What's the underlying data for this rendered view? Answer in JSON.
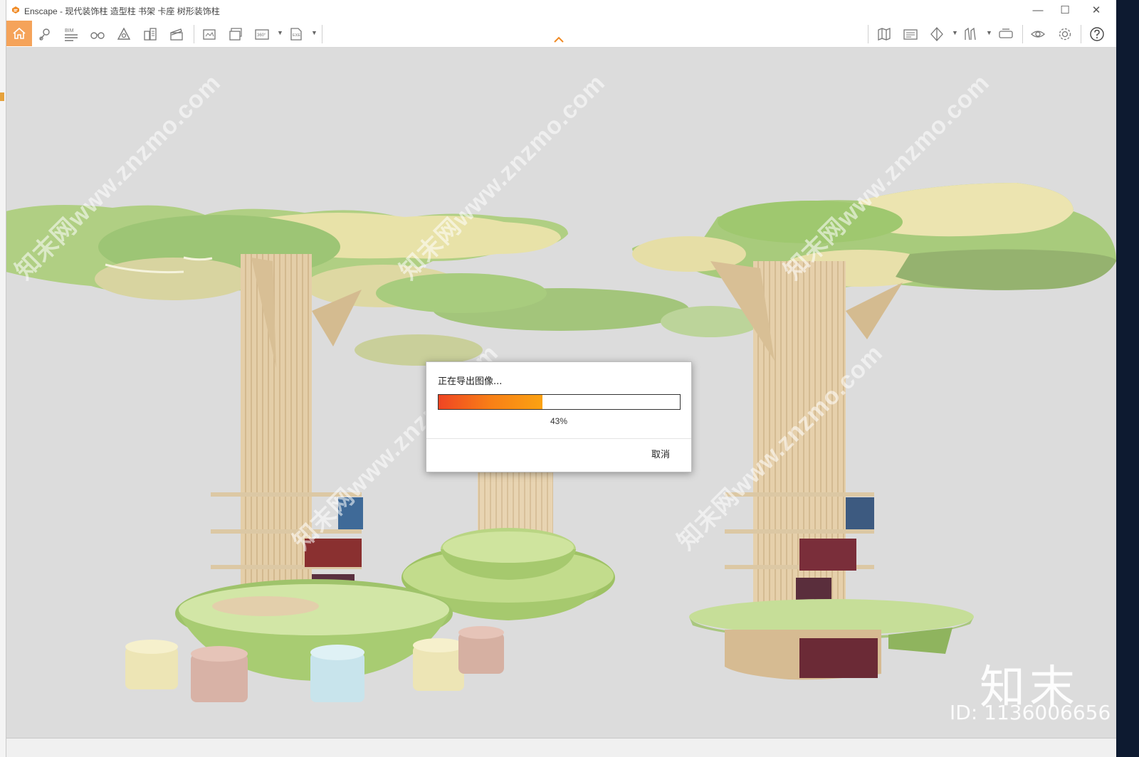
{
  "window": {
    "title": "Enscape - 现代装饰柱 造型柱 书架 卡座 树形装饰柱",
    "minimize_label": "—",
    "maximize_label": "☐",
    "close_label": "✕"
  },
  "toolbar": {
    "accent_color": "#f5a35a",
    "bim_label": "BIM",
    "left_tools": [
      "home-icon",
      "location-pin-icon",
      "bim-icon",
      "binoculars-icon",
      "asset-library-icon",
      "buildings-icon",
      "clapper-icon",
      "screenshot-icon",
      "batch-render-icon",
      "panorama-360-icon",
      "exe-export-icon"
    ],
    "right_tools": [
      "map-icon",
      "visual-settings-icon",
      "views-icon",
      "collaborate-icon",
      "vr-headset-icon",
      "eye-icon",
      "gear-icon",
      "help-icon"
    ]
  },
  "export_dialog": {
    "title": "正在导出图像...",
    "progress": 0.43,
    "progress_label": "43%",
    "cancel_label": "取消"
  },
  "watermarks": {
    "site_text": "知末网www.znzmo.com",
    "brand_name": "知末",
    "id_text": "ID: 1136006656"
  }
}
